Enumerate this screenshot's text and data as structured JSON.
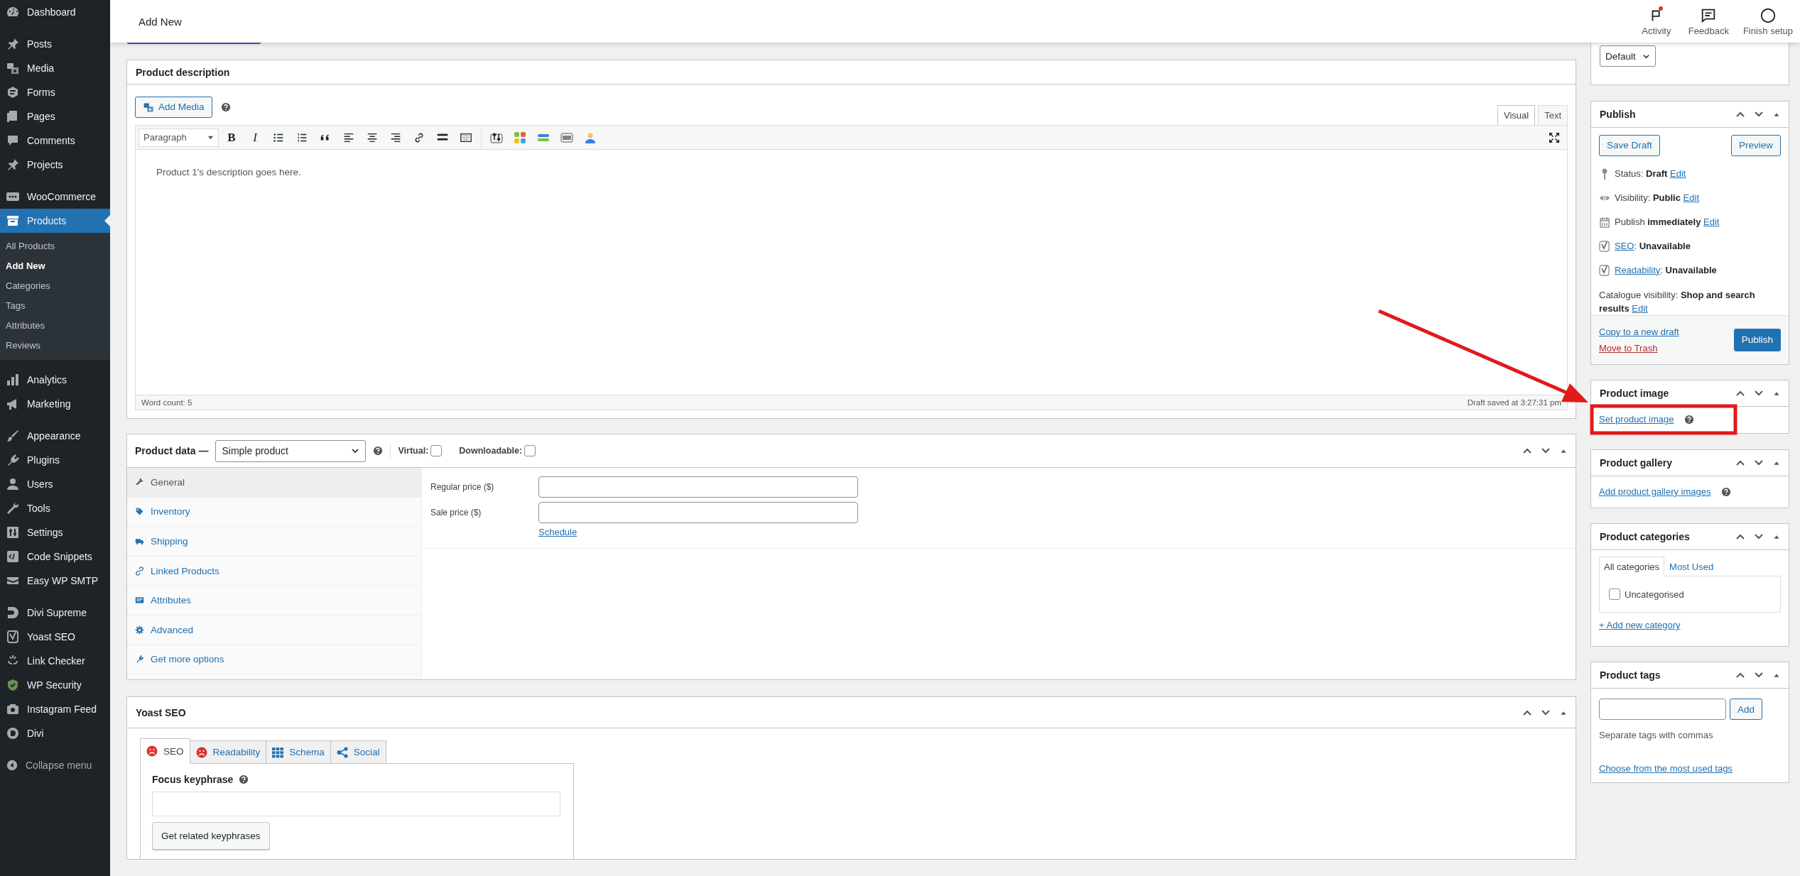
{
  "admin_menu": {
    "groups": [
      [
        {
          "label": "Dashboard",
          "selected": false
        }
      ],
      [
        {
          "label": "Posts",
          "selected": false
        },
        {
          "label": "Media",
          "selected": false
        },
        {
          "label": "Forms",
          "selected": false
        },
        {
          "label": "Pages",
          "selected": false
        },
        {
          "label": "Comments",
          "selected": false
        },
        {
          "label": "Projects",
          "selected": false
        }
      ],
      [
        {
          "label": "WooCommerce",
          "selected": false
        },
        {
          "label": "Products",
          "selected": true,
          "submenu": [
            {
              "label": "All Products",
              "selected": false
            },
            {
              "label": "Add New",
              "selected": true
            },
            {
              "label": "Categories",
              "selected": false
            },
            {
              "label": "Tags",
              "selected": false
            },
            {
              "label": "Attributes",
              "selected": false
            },
            {
              "label": "Reviews",
              "selected": false
            }
          ]
        }
      ],
      [
        {
          "label": "Analytics",
          "selected": false
        },
        {
          "label": "Marketing",
          "selected": false
        }
      ],
      [
        {
          "label": "Appearance",
          "selected": false
        },
        {
          "label": "Plugins",
          "selected": false
        },
        {
          "label": "Users",
          "selected": false
        },
        {
          "label": "Tools",
          "selected": false
        },
        {
          "label": "Settings",
          "selected": false
        },
        {
          "label": "Code Snippets",
          "selected": false
        },
        {
          "label": "Easy WP SMTP",
          "selected": false
        }
      ],
      [
        {
          "label": "Divi Supreme",
          "selected": false
        },
        {
          "label": "Yoast SEO",
          "selected": false
        },
        {
          "label": "Link Checker",
          "selected": false
        },
        {
          "label": "WP Security",
          "selected": false
        },
        {
          "label": "Instagram Feed",
          "selected": false
        },
        {
          "label": "Divi",
          "selected": false
        }
      ]
    ],
    "collapse": "Collapse menu"
  },
  "topbar": {
    "title": "Add New",
    "actions": [
      {
        "label": "Activity",
        "unread": true
      },
      {
        "label": "Feedback",
        "unread": false
      },
      {
        "label": "Finish setup",
        "unread": false
      }
    ]
  },
  "description": {
    "title": "Product description",
    "add_media": "Add Media",
    "editor_tabs": [
      {
        "label": "Visual",
        "selected": true
      },
      {
        "label": "Text",
        "selected": false
      }
    ],
    "format": "Paragraph",
    "text_buttons": [
      "B",
      "I"
    ],
    "content": "Product 1's description goes here.",
    "word_count": "Word count: 5",
    "saved": "Draft saved at 3:27:31 pm"
  },
  "product_data": {
    "title": "Product data —",
    "type": "Simple product",
    "options": [
      {
        "label": "Virtual:",
        "checked": false
      },
      {
        "label": "Downloadable:",
        "checked": false
      }
    ],
    "tabs": [
      {
        "label": "General",
        "selected": true
      },
      {
        "label": "Inventory",
        "selected": false
      },
      {
        "label": "Shipping",
        "selected": false
      },
      {
        "label": "Linked Products",
        "selected": false
      },
      {
        "label": "Attributes",
        "selected": false
      },
      {
        "label": "Advanced",
        "selected": false
      },
      {
        "label": "Get more options",
        "selected": false
      }
    ],
    "fields": [
      {
        "label": "Regular price ($)"
      },
      {
        "label": "Sale price ($)",
        "link": "Schedule"
      }
    ]
  },
  "yoast": {
    "title": "Yoast SEO",
    "tabs": [
      {
        "label": "SEO",
        "selected": true
      },
      {
        "label": "Readability",
        "selected": false
      },
      {
        "label": "Schema",
        "selected": false
      },
      {
        "label": "Social",
        "selected": false
      }
    ],
    "focus_label": "Focus keyphrase",
    "button": "Get related keyphrases"
  },
  "template": {
    "value": "Default"
  },
  "publish": {
    "title": "Publish",
    "save_draft": "Save Draft",
    "preview": "Preview",
    "rows": [
      {
        "before": "Status: **Draft**",
        "link": "Edit"
      },
      {
        "before": "Visibility: **Public**",
        "link": "Edit"
      },
      {
        "before": "Publish **immediately**",
        "link": "Edit"
      },
      {
        "link": "SEO",
        "after": ": **Unavailable**"
      },
      {
        "link": "Readability",
        "after": ": **Unavailable**"
      },
      {
        "before": "Catalogue visibility: **Shop and search results**",
        "link": "Edit"
      }
    ],
    "copy": "Copy to a new draft",
    "trash": "Move to Trash",
    "publish": "Publish"
  },
  "product_image": {
    "title": "Product image",
    "link": "Set product image"
  },
  "product_gallery": {
    "title": "Product gallery",
    "link": "Add product gallery images"
  },
  "product_categories": {
    "title": "Product categories",
    "tabs": [
      {
        "label": "All categories",
        "selected": true
      },
      {
        "label": "Most Used",
        "selected": false
      }
    ],
    "items": [
      {
        "label": "Uncategorised",
        "checked": false
      }
    ],
    "add": "+ Add new category"
  },
  "product_tags": {
    "title": "Product tags",
    "button": "Add",
    "hint": "Separate tags with commas",
    "link": "Choose from the most used tags"
  }
}
